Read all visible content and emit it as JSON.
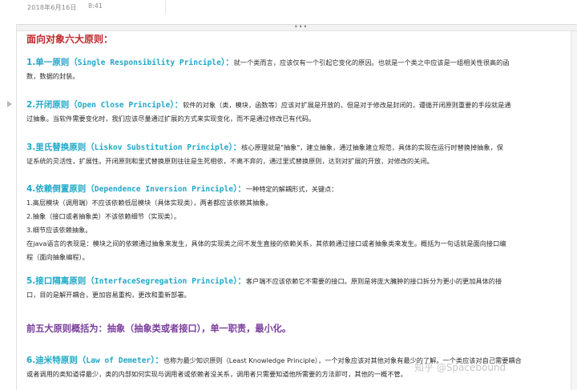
{
  "header": {
    "date": "2018年6月16日",
    "time": "8:41"
  },
  "frame": {
    "grip": "•••"
  },
  "title": "面向对象六大原则：",
  "sections": [
    {
      "heading": "1.单一原则（",
      "heading_en": "Single Responsibility Principle",
      "heading_tail": "）：",
      "lines": [
        "就一个类而言，应该仅有一个引起它变化的原因。也就是一个类之中应该是一组相关性很高的函",
        "数，数据的封装。"
      ]
    },
    {
      "heading": "2.开闭原则（",
      "heading_en": "Open Close Principle",
      "heading_tail": "）：",
      "lines": [
        "软件的对象（类，模块，函数等）应该对扩展是开放的，但是对于修改是封闭的，遵循开闭原则重要的手段就是通",
        "过抽象。当软件需要变化时，我们应该尽量通过扩展的方式来实现变化，而不是通过修改已有代码。"
      ]
    },
    {
      "heading": "3.里氏替换原则（",
      "heading_en": "Liskov Substitution Principle",
      "heading_tail": "）：",
      "lines": [
        "核心原理就是\"抽象\"，建立抽象，通过抽象建立规范，具体的实现在运行时替换掉抽象，保",
        "证系统的灵活性，扩展性。开闭原则和里式替换原则往往是生死相依，不离不弃的，通过里式替换原则，达到对扩展的开放，对修改的关闭。"
      ]
    },
    {
      "heading": "4.依赖倒置原则（",
      "heading_en": "Dependence Inversion Principle",
      "heading_tail": "）：",
      "lines": [
        "一种特定的解耦形式，关键点：",
        "1.高层模块（调用端）不应该依赖低层模块（具体实现类），两者都应该依赖其抽象。",
        "2.抽象（接口或者抽象类）不该依赖细节（实现类）。",
        "3.细节应该依赖抽象。",
        "在java语言的表现是：模块之间的依赖通过抽象来发生，具体的实现类之间不发生直接的依赖关系，其依赖通过接口或者抽象类来发生。概括为一句话就是面向接口编",
        "程（面向抽象编程）。"
      ]
    },
    {
      "heading": "5.接口隔离原则（",
      "heading_en": "InterfaceSegregation Principle",
      "heading_tail": "）：",
      "lines": [
        "客户端不应该依赖它不需要的接口。原则是将庞大臃肿的接口拆分为更小的更加具体的接",
        "口，目的是解开耦合，更加容易重构，更改和重新部署。"
      ]
    },
    {
      "heading": "6.迪米特原则（",
      "heading_en": "Law of Demeter",
      "heading_tail": "）：",
      "lines": [
        "也称为最少知识原则（Least Knowledge Principle），一个对象应该对其他对象有最少的了解。一个类应该对自己需要耦合",
        "或者调用的类知道得最少，类的内部如何实现与调用者或依赖者没关系，调用者只需要知道他所需要的方法即可，其他的一概不管。"
      ]
    }
  ],
  "summary": "前五大原则概括为：抽象（抽象类或者接口），单一职责，最小化。",
  "watermark": "知乎 @Spacebound",
  "colors": {
    "title": "#c0282d",
    "heading": "#20a8c8",
    "summary": "#7a3d9c"
  }
}
